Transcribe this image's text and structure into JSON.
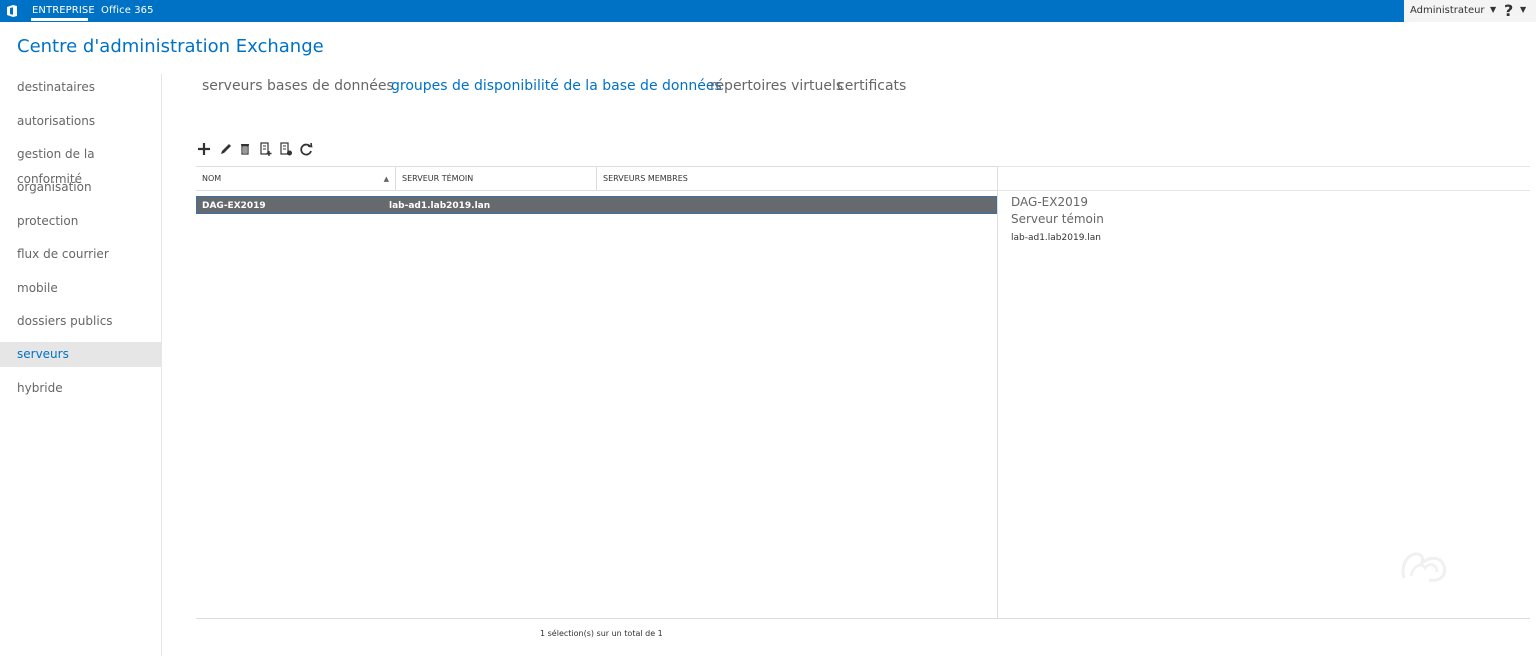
{
  "topbar": {
    "entreprise": "ENTREPRISE",
    "office365": "Office 365",
    "user": "Administrateur",
    "help": "?"
  },
  "app_title": "Centre d'administration Exchange",
  "nav": [
    {
      "label": "destinataires"
    },
    {
      "label": "autorisations"
    },
    {
      "label": "gestion de la conformité"
    },
    {
      "label": "organisation"
    },
    {
      "label": "protection"
    },
    {
      "label": "flux de courrier"
    },
    {
      "label": "mobile"
    },
    {
      "label": "dossiers publics"
    },
    {
      "label": "serveurs",
      "active": true
    },
    {
      "label": "hybride"
    }
  ],
  "tabs": [
    {
      "label": "serveurs"
    },
    {
      "label": "bases de données"
    },
    {
      "label": "groupes de disponibilité de la base de données",
      "active": true
    },
    {
      "label": "répertoires virtuels"
    },
    {
      "label": "certificats"
    }
  ],
  "toolbar": [
    "add-icon",
    "edit-icon",
    "delete-icon",
    "add-member-icon",
    "manage-membership-icon",
    "refresh-icon"
  ],
  "grid": {
    "columns": [
      "NOM",
      "SERVEUR TÉMOIN",
      "SERVEURS MEMBRES"
    ],
    "rows": [
      {
        "name": "DAG-EX2019",
        "witness": "lab-ad1.lab2019.lan",
        "members": ""
      }
    ]
  },
  "details": {
    "title": "DAG-EX2019",
    "label": "Serveur témoin",
    "value": "lab-ad1.lab2019.lan"
  },
  "status": "1 sélection(s) sur un total de 1",
  "colors": {
    "accent": "#0072c6",
    "selected_row": "#666a6e"
  }
}
